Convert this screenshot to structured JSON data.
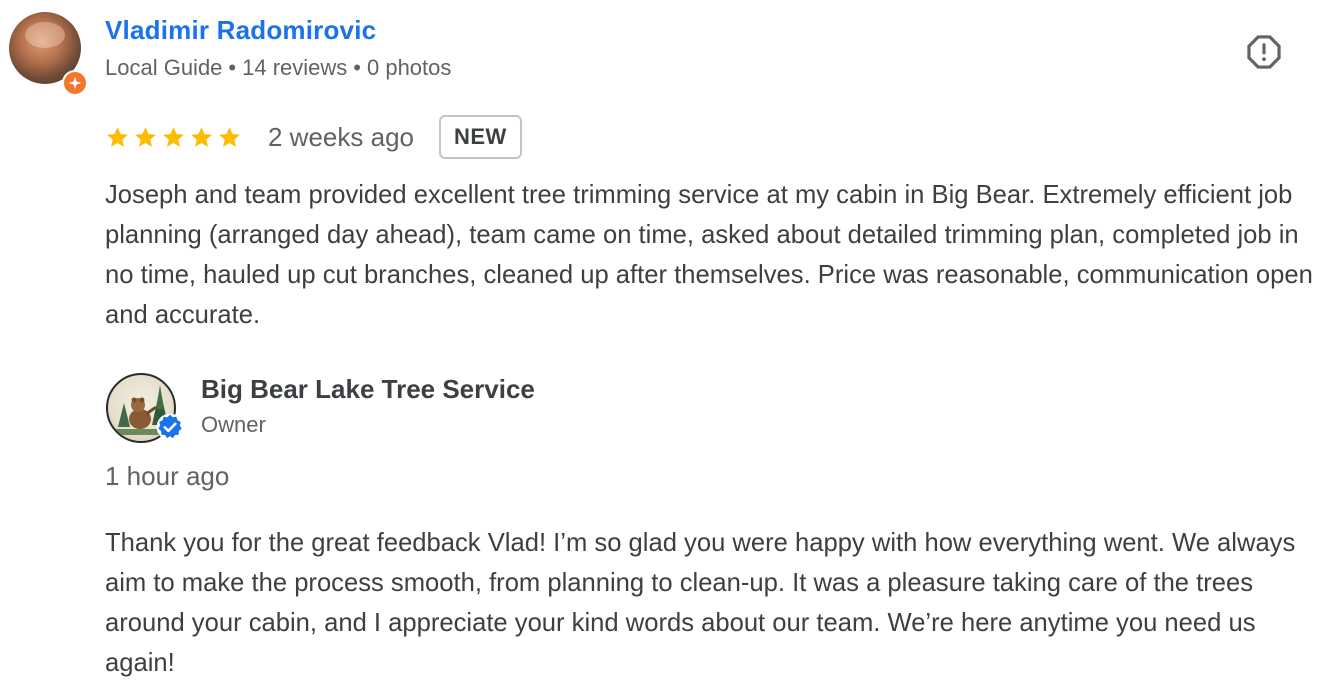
{
  "review": {
    "reviewer_name": "Vladimir Radomirovic",
    "reviewer_level": "Local Guide",
    "reviews_count": "14 reviews",
    "photos_count": "0 photos",
    "separator": "•",
    "rating": 5,
    "time_ago": "2 weeks ago",
    "badge": "NEW",
    "text": "Joseph and team provided excellent tree trimming service at my cabin in Big Bear. Extremely efficient job planning (arranged day ahead), team came on time, asked about detailed trimming plan, completed job in no time, hauled up cut branches, cleaned up after themselves. Price was reasonable, communication open and accurate."
  },
  "reply": {
    "owner_name": "Big Bear Lake Tree Service",
    "owner_role": "Owner",
    "time_ago": "1 hour ago",
    "text": "Thank you for the great feedback Vlad! I’m so glad you were happy with how everything went. We always aim to make the process smooth, from planning to clean-up. It was a pleasure taking care of the trees around your cabin, and I appreciate your kind words about our team. We’re here anytime you need us again!"
  },
  "icons": {
    "report": "report-flag-icon",
    "star": "star-icon",
    "verified": "verified-check-icon",
    "local_guide": "local-guide-badge-icon"
  },
  "colors": {
    "link_blue": "#1a73e8",
    "star_gold": "#fbbc04",
    "local_guide_orange": "#f4762b",
    "verified_blue": "#1a73e8",
    "text_primary": "#3c4043",
    "text_secondary": "#5f6368"
  }
}
